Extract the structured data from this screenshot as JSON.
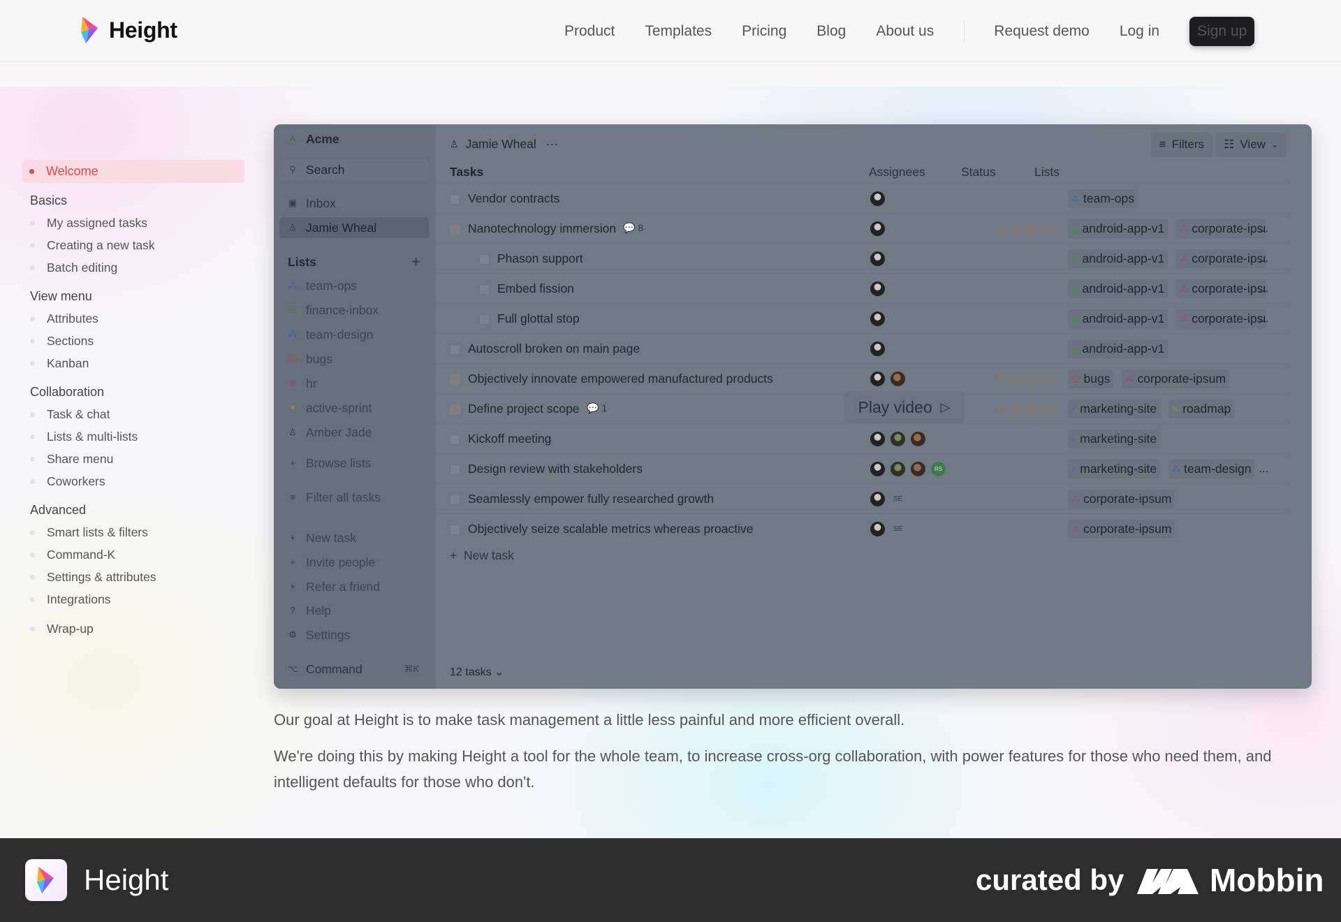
{
  "header": {
    "brand": "Height",
    "nav": [
      "Product",
      "Templates",
      "Pricing",
      "Blog",
      "About us"
    ],
    "request_demo": "Request demo",
    "login": "Log in",
    "signup": "Sign up"
  },
  "docs": {
    "welcome": "Welcome",
    "groups": [
      {
        "title": "Basics",
        "items": [
          "My assigned tasks",
          "Creating a new task",
          "Batch editing"
        ]
      },
      {
        "title": "View menu",
        "items": [
          "Attributes",
          "Sections",
          "Kanban"
        ]
      },
      {
        "title": "Collaboration",
        "items": [
          "Task & chat",
          "Lists & multi-lists",
          "Share menu",
          "Coworkers"
        ]
      },
      {
        "title": "Advanced",
        "items": [
          "Smart lists & filters",
          "Command-K",
          "Settings & attributes",
          "Integrations"
        ]
      }
    ],
    "wrapup": "Wrap-up"
  },
  "app": {
    "workspace": "Acme",
    "search": "Search",
    "inbox": "Inbox",
    "user": "Jamie Wheal",
    "lists_title": "Lists",
    "lists": [
      "team-ops",
      "finance-inbox",
      "team-design",
      "bugs",
      "hr",
      "active-sprint",
      "Amber Jade"
    ],
    "browse": "Browse lists",
    "filter": "Filter all tasks",
    "new_task": "New task",
    "invite": "Invite people",
    "refer": "Refer a friend",
    "help": "Help",
    "settings": "Settings",
    "command": "Command",
    "command_kbd": "⌘K",
    "title": "Jamie Wheal",
    "filters": "Filters",
    "view": "View",
    "columns": {
      "tasks": "Tasks",
      "assignees": "Assignees",
      "status": "Status",
      "lists": "Lists"
    },
    "tasks": [
      {
        "title": "Vendor contracts",
        "indent": 0,
        "status": "",
        "comments": "",
        "lists": [
          "team-ops"
        ],
        "avatars": [
          "a1"
        ]
      },
      {
        "title": "Nanotechnology immersion",
        "indent": 0,
        "status": "In progress",
        "comments": "8",
        "lists": [
          "android-app-v1",
          "corporate-ipsum"
        ],
        "avatars": [
          "a1"
        ]
      },
      {
        "title": "Phason support",
        "indent": 1,
        "status": "",
        "comments": "",
        "lists": [
          "android-app-v1",
          "corporate-ipsum"
        ],
        "avatars": [
          "a1"
        ]
      },
      {
        "title": "Embed fission",
        "indent": 1,
        "status": "",
        "comments": "",
        "lists": [
          "android-app-v1",
          "corporate-ipsum"
        ],
        "avatars": [
          "a1"
        ]
      },
      {
        "title": "Full glottal stop",
        "indent": 1,
        "status": "",
        "comments": "",
        "lists": [
          "android-app-v1",
          "corporate-ipsum"
        ],
        "avatars": [
          "a1"
        ]
      },
      {
        "title": "Autoscroll broken on main page",
        "indent": 0,
        "status": "",
        "comments": "",
        "lists": [
          "android-app-v1"
        ],
        "avatars": [
          "a1"
        ]
      },
      {
        "title": "Objectively innovate empowered manufactured products",
        "indent": 0,
        "status": "In progress",
        "comments": "",
        "lists": [
          "bugs",
          "corporate-ipsum"
        ],
        "avatars": [
          "a1",
          "a2"
        ]
      },
      {
        "title": "Define project scope",
        "indent": 0,
        "status": "In progress",
        "comments": "1",
        "lists": [
          "marketing-site",
          "roadmap"
        ],
        "avatars": [
          "a1"
        ]
      },
      {
        "title": "Kickoff meeting",
        "indent": 0,
        "status": "",
        "comments": "",
        "lists": [
          "marketing-site"
        ],
        "avatars": [
          "a1",
          "a3",
          "a2"
        ]
      },
      {
        "title": "Design review with stakeholders",
        "indent": 0,
        "status": "",
        "comments": "",
        "lists": [
          "marketing-site",
          "team-design"
        ],
        "avatars": [
          "a1",
          "a3",
          "a2",
          "RS"
        ]
      },
      {
        "title": "Seamlessly empower fully researched growth",
        "indent": 0,
        "status": "",
        "comments": "",
        "lists": [
          "corporate-ipsum"
        ],
        "avatars": [
          "a1",
          "SE"
        ]
      },
      {
        "title": "Objectively seize scalable metrics whereas proactive",
        "indent": 0,
        "status": "",
        "comments": "",
        "lists": [
          "corporate-ipsum"
        ],
        "avatars": [
          "a1",
          "SE"
        ]
      }
    ],
    "new_task_row": "New task",
    "count": "12 tasks",
    "play_video": "Play video"
  },
  "copy": {
    "p1": "Our goal at Height is to make task management a little less painful and more efficient overall.",
    "p2": "We're doing this by making Height a tool for the whole team, to increase cross-org collaboration, with power features for those who need them, and intelligent defaults for those who don't."
  },
  "footer": {
    "app_name": "Height",
    "curated": "curated by",
    "mobbin": "Mobbin"
  },
  "colors": {
    "accent_red": "#e5484d",
    "dark": "#1d1d1f",
    "footer_bg": "#2d2d2d"
  }
}
